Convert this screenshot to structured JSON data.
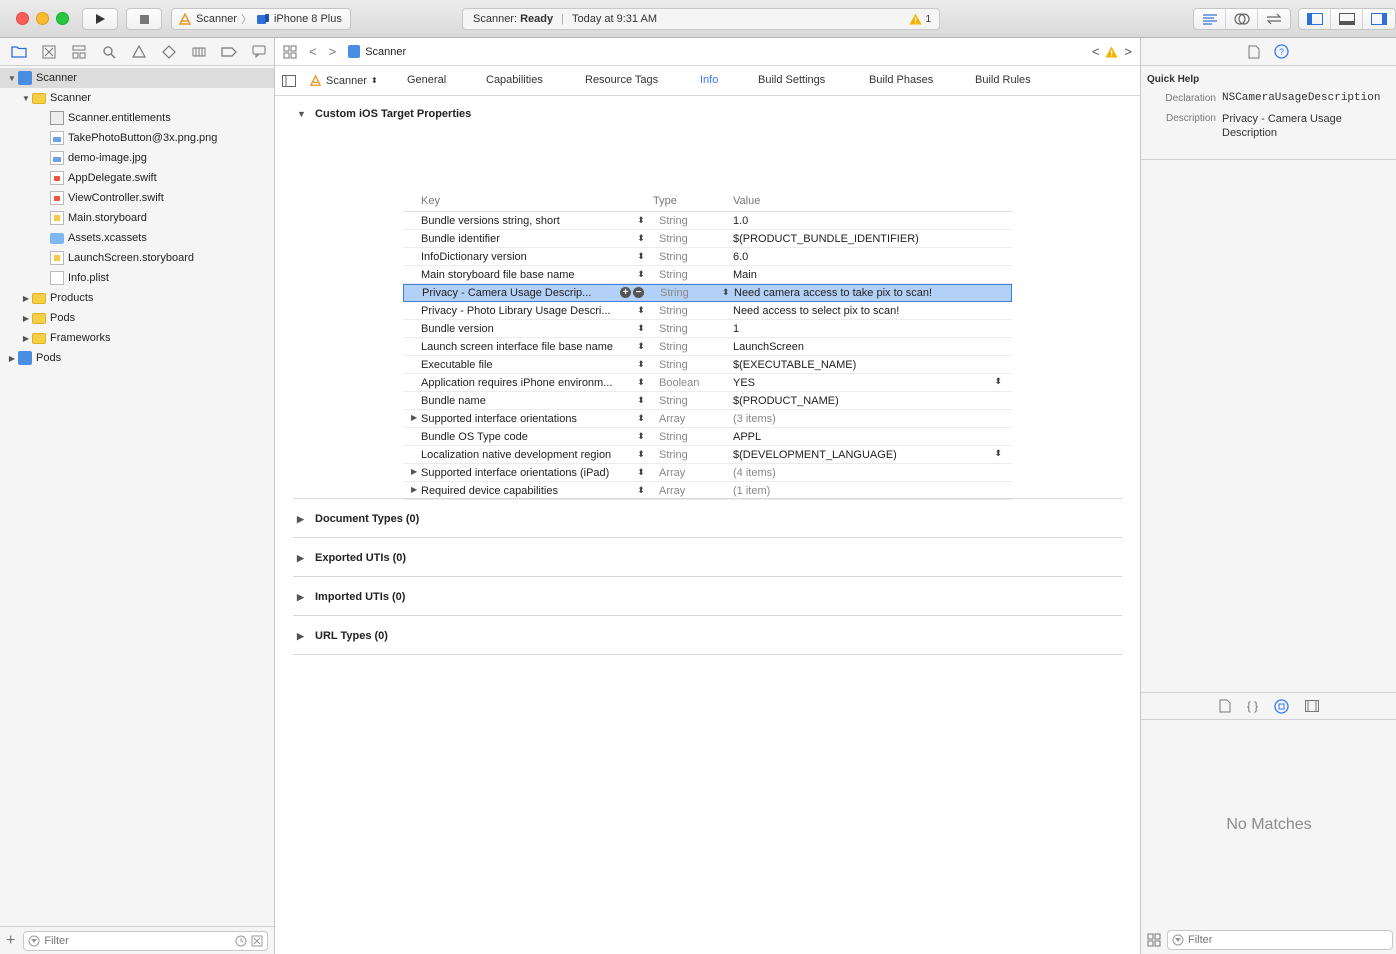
{
  "toolbar": {
    "scheme_target": "Scanner",
    "scheme_device": "iPhone 8 Plus",
    "status_prefix": "Scanner:",
    "status_state": "Ready",
    "status_time": "Today at 9:31 AM",
    "warning_count": "1"
  },
  "navigator": {
    "items": [
      {
        "label": "Scanner",
        "icon": "project-icon"
      },
      {
        "label": "Scanner",
        "icon": "folder-icon"
      },
      {
        "label": "Scanner.entitlements",
        "icon": "entitlements-file-icon"
      },
      {
        "label": "TakePhotoButton@3x.png.png",
        "icon": "image-file-icon"
      },
      {
        "label": "demo-image.jpg",
        "icon": "image-file-icon"
      },
      {
        "label": "AppDelegate.swift",
        "icon": "swift-file-icon"
      },
      {
        "label": "ViewController.swift",
        "icon": "swift-file-icon"
      },
      {
        "label": "Main.storyboard",
        "icon": "storyboard-file-icon"
      },
      {
        "label": "Assets.xcassets",
        "icon": "asset-catalog-icon"
      },
      {
        "label": "LaunchScreen.storyboard",
        "icon": "storyboard-file-icon"
      },
      {
        "label": "Info.plist",
        "icon": "plist-file-icon"
      },
      {
        "label": "Products",
        "icon": "folder-icon"
      },
      {
        "label": "Pods",
        "icon": "folder-icon"
      },
      {
        "label": "Frameworks",
        "icon": "folder-icon"
      },
      {
        "label": "Pods",
        "icon": "project-icon"
      }
    ],
    "filter_placeholder": "Filter"
  },
  "editor": {
    "breadcrumb": "Scanner",
    "target": "Scanner",
    "tabs": [
      "General",
      "Capabilities",
      "Resource Tags",
      "Info",
      "Build Settings",
      "Build Phases",
      "Build Rules"
    ],
    "active_tab": "Info",
    "sections": {
      "custom": "Custom iOS Target Properties",
      "document_types": "Document Types (0)",
      "exported_utis": "Exported UTIs (0)",
      "imported_utis": "Imported UTIs (0)",
      "url_types": "URL Types (0)"
    },
    "columns": {
      "key": "Key",
      "type": "Type",
      "value": "Value"
    },
    "properties": [
      {
        "key": "Bundle versions string, short",
        "type": "String",
        "value": "1.0"
      },
      {
        "key": "Bundle identifier",
        "type": "String",
        "value": "$(PRODUCT_BUNDLE_IDENTIFIER)"
      },
      {
        "key": "InfoDictionary version",
        "type": "String",
        "value": "6.0"
      },
      {
        "key": "Main storyboard file base name",
        "type": "String",
        "value": "Main"
      },
      {
        "key": "Privacy - Camera Usage Descrip...",
        "type": "String",
        "value": "Need camera access to take pix to scan!"
      },
      {
        "key": "Privacy - Photo Library Usage Descri...",
        "type": "String",
        "value": "Need access to select pix to scan!"
      },
      {
        "key": "Bundle version",
        "type": "String",
        "value": "1"
      },
      {
        "key": "Launch screen interface file base name",
        "type": "String",
        "value": "LaunchScreen"
      },
      {
        "key": "Executable file",
        "type": "String",
        "value": "$(EXECUTABLE_NAME)"
      },
      {
        "key": "Application requires iPhone environm...",
        "type": "Boolean",
        "value": "YES"
      },
      {
        "key": "Bundle name",
        "type": "String",
        "value": "$(PRODUCT_NAME)"
      },
      {
        "key": "Supported interface orientations",
        "type": "Array",
        "value": "(3 items)"
      },
      {
        "key": "Bundle OS Type code",
        "type": "String",
        "value": "APPL"
      },
      {
        "key": "Localization native development region",
        "type": "String",
        "value": "$(DEVELOPMENT_LANGUAGE)"
      },
      {
        "key": "Supported interface orientations (iPad)",
        "type": "Array",
        "value": "(4 items)"
      },
      {
        "key": "Required device capabilities",
        "type": "Array",
        "value": "(1 item)"
      }
    ]
  },
  "inspector": {
    "quick_help_title": "Quick Help",
    "declaration_label": "Declaration",
    "declaration_value": "NSCameraUsageDescription",
    "description_label": "Description",
    "description_value": "Privacy - Camera Usage Description",
    "no_matches": "No Matches",
    "filter_placeholder": "Filter"
  },
  "colors": {
    "accent": "#3478f6",
    "selection": "#b3d1f7",
    "warning": "#f5b400"
  }
}
